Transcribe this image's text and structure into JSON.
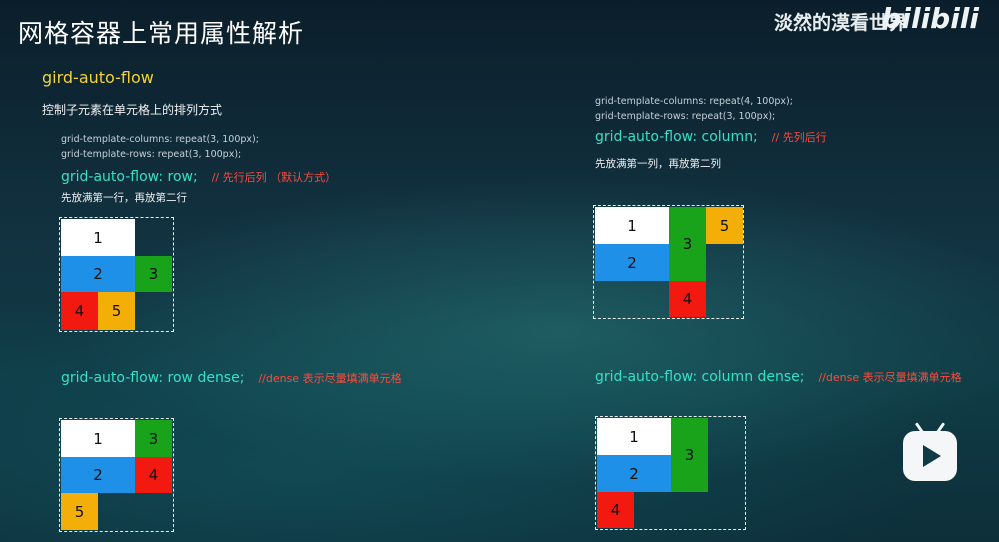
{
  "header": {
    "title": "网格容器上常用属性解析",
    "watermark": "淡然的漠看世界",
    "logo": "bilibili"
  },
  "section": {
    "subtitle": "gird-auto-flow",
    "description": "控制子元素在单元格上的排列方式"
  },
  "example_row": {
    "code_line_1": "grid-template-columns: repeat(3, 100px);",
    "code_line_2": "grid-template-rows: repeat(3, 100px);",
    "property": "grid-auto-flow: row;",
    "comment": "// 先行后列 （默认方式）",
    "note": "先放满第一行，再放第二行",
    "cells": [
      "1",
      "2",
      "3",
      "4",
      "5"
    ]
  },
  "example_column": {
    "code_line_1": "grid-template-columns: repeat(4, 100px);",
    "code_line_2": "grid-template-rows: repeat(3, 100px);",
    "property": "grid-auto-flow: column;",
    "comment": "// 先列后行",
    "note": "先放满第一列，再放第二列",
    "cells": [
      "1",
      "2",
      "3",
      "4",
      "5"
    ]
  },
  "example_row_dense": {
    "property": "grid-auto-flow: row dense;",
    "comment": "//dense 表示尽量填满单元格",
    "cells": [
      "1",
      "2",
      "3",
      "4",
      "5"
    ]
  },
  "example_column_dense": {
    "property": "grid-auto-flow: column dense;",
    "comment": "//dense 表示尽量填满单元格",
    "cells": [
      "1",
      "2",
      "3",
      "4"
    ]
  },
  "colors": {
    "item_1": "#ffffff",
    "item_2": "#1e90e8",
    "item_3": "#19a31b",
    "item_4": "#f21a10",
    "item_5": "#f4ae08"
  },
  "player": {
    "icon": "play-icon"
  }
}
